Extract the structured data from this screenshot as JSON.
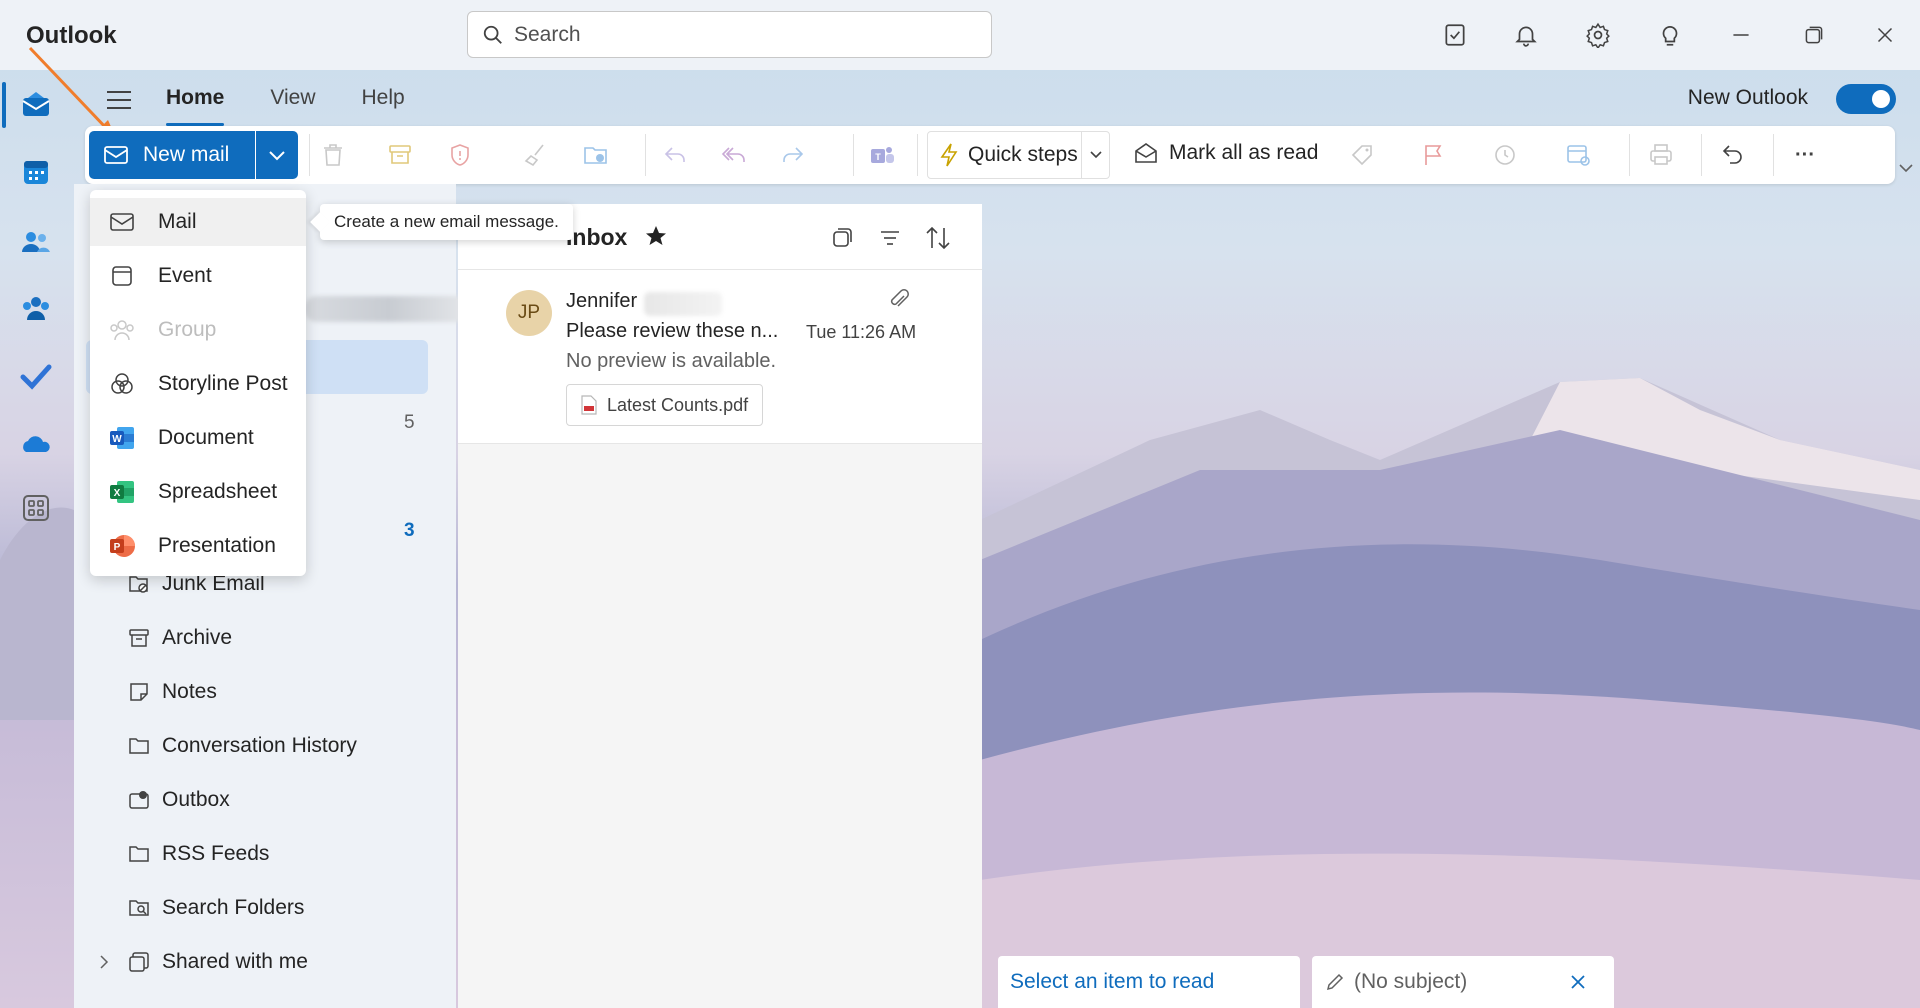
{
  "app": {
    "title": "Outlook"
  },
  "search": {
    "placeholder": "Search"
  },
  "titlebar_icons": [
    "my-day-icon",
    "bell-icon",
    "gear-icon",
    "lightbulb-icon",
    "minimize-icon",
    "restore-icon",
    "close-icon"
  ],
  "tabs": [
    {
      "label": "Home",
      "active": true
    },
    {
      "label": "View",
      "active": false
    },
    {
      "label": "Help",
      "active": false
    }
  ],
  "new_outlook": {
    "label": "New Outlook",
    "enabled": true
  },
  "ribbon": {
    "new_mail_label": "New mail",
    "quick_steps_label": "Quick steps",
    "mark_all_read_label": "Mark all as read",
    "more_label": "···"
  },
  "new_menu": {
    "items": [
      {
        "label": "Mail",
        "icon": "mail-icon",
        "disabled": false
      },
      {
        "label": "Event",
        "icon": "calendar-icon",
        "disabled": false
      },
      {
        "label": "Group",
        "icon": "group-icon",
        "disabled": true
      },
      {
        "label": "Storyline Post",
        "icon": "storyline-icon",
        "disabled": false
      },
      {
        "label": "Document",
        "icon": "word-icon",
        "disabled": false
      },
      {
        "label": "Spreadsheet",
        "icon": "excel-icon",
        "disabled": false
      },
      {
        "label": "Presentation",
        "icon": "powerpoint-icon",
        "disabled": false
      }
    ],
    "tooltip": "Create a new email message."
  },
  "folders": {
    "counts": [
      "5",
      "3"
    ],
    "items": [
      {
        "label": "Junk Email",
        "icon": "junk-icon"
      },
      {
        "label": "Archive",
        "icon": "archive-icon"
      },
      {
        "label": "Notes",
        "icon": "notes-icon"
      },
      {
        "label": "Conversation History",
        "icon": "folder-icon"
      },
      {
        "label": "Outbox",
        "icon": "outbox-icon"
      },
      {
        "label": "RSS Feeds",
        "icon": "folder-icon"
      },
      {
        "label": "Search Folders",
        "icon": "search-folder-icon"
      },
      {
        "label": "Shared with me",
        "icon": "shared-icon"
      }
    ]
  },
  "message_list": {
    "title": "Inbox",
    "messages": [
      {
        "initials": "JP",
        "sender": "Jennifer",
        "subject": "Please review these n...",
        "time": "Tue 11:26 AM",
        "preview": "No preview is available.",
        "attachment": "Latest Counts.pdf"
      }
    ]
  },
  "bottom_tabs": {
    "reading": "Select an item to read",
    "draft": "(No subject)"
  },
  "colors": {
    "accent": "#0f6cbd",
    "selected_folder": "#cfe0f5",
    "annotation_arrow": "#f07d2c"
  }
}
